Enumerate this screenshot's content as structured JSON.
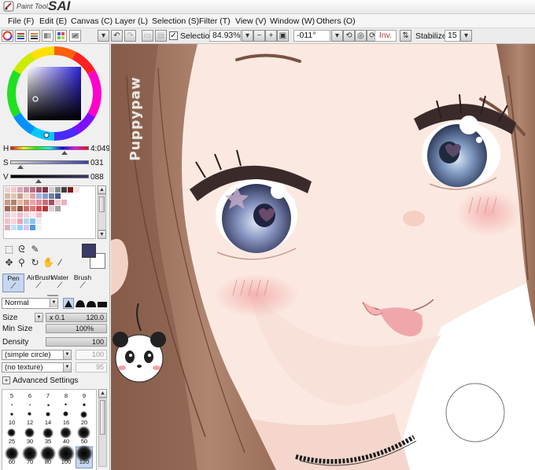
{
  "app": {
    "title_small": "Paint Tool",
    "title_large": "SAI"
  },
  "menu": [
    "File (F)",
    "Edit (E)",
    "Canvas (C)",
    "Layer (L)",
    "Selection (S)",
    "Filter (T)",
    "View (V)",
    "Window (W)",
    "Others (O)"
  ],
  "toolbar": {
    "selection_label": "Selection",
    "selection_checked": true,
    "zoom": "84.93%",
    "minus": "−",
    "plus": "+",
    "rotation": "-011°",
    "inv_label": "Inv.",
    "stabilizer_label": "Stabilizer",
    "stabilizer_value": "15"
  },
  "color_sliders": [
    {
      "label": "H",
      "value": "4:049"
    },
    {
      "label": "S",
      "value": "031"
    },
    {
      "label": "V",
      "value": "088"
    }
  ],
  "brush_tabs": [
    "Pen",
    "AirBrush",
    "Water",
    "Brush"
  ],
  "properties": {
    "blend_mode": "Normal",
    "size_label": "Size",
    "size_multiplier": "x 0.1",
    "size_value": "120.0",
    "min_size_label": "Min Size",
    "min_size_value": "100%",
    "density_label": "Density",
    "density_value": "100",
    "shape_select": "(simple circle)",
    "shape_value": "100",
    "texture_select": "(no texture)",
    "texture_value": "95",
    "advanced_label": "Advanced Settings",
    "advanced_toggle": "+"
  },
  "brush_sizes": [
    [
      "5",
      "6",
      "7",
      "8",
      "9"
    ],
    [
      "10",
      "12",
      "14",
      "16",
      "20"
    ],
    [
      "25",
      "30",
      "35",
      "40",
      "50"
    ],
    [
      "60",
      "70",
      "80",
      "100",
      "120"
    ]
  ],
  "canvas": {
    "watermark": "Puppypaw"
  },
  "colors": {
    "accent": "#3a3a66",
    "selected_brush_bg": "#c9d7ee",
    "skin": "#fbe8e0",
    "hair": "#a87a63"
  }
}
